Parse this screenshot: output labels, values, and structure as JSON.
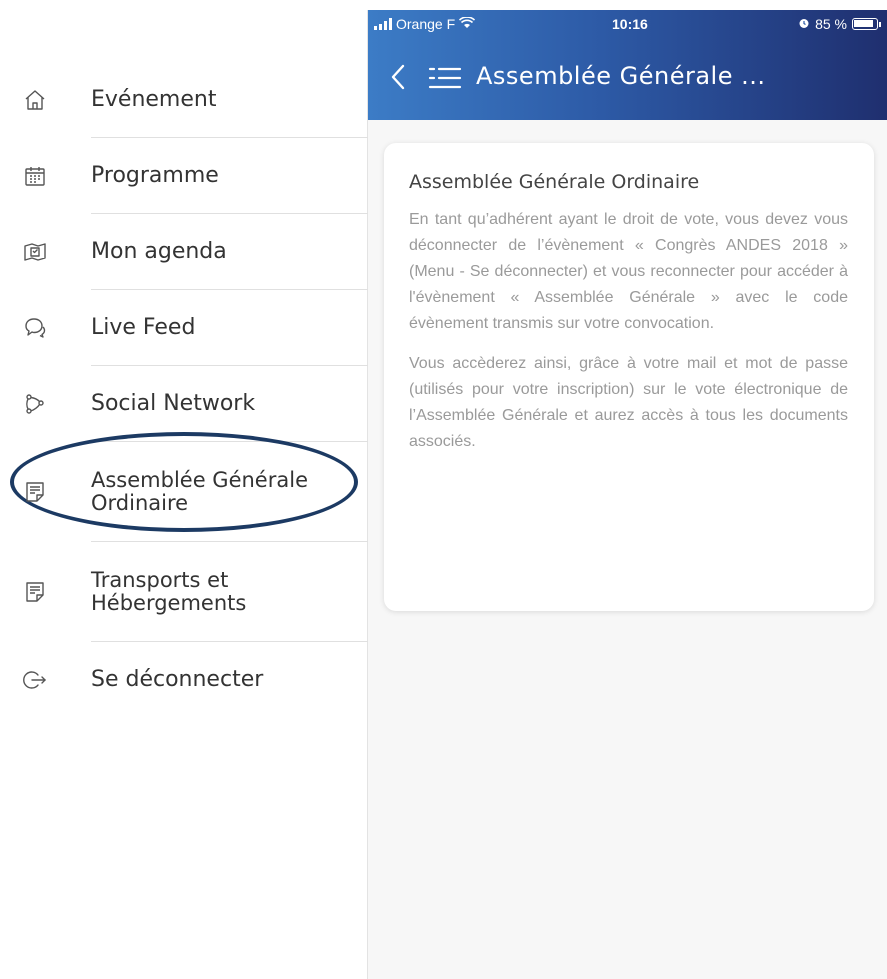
{
  "status_bar": {
    "carrier": "Orange F",
    "time": "10:16",
    "battery": "85 %"
  },
  "navbar": {
    "title": "Assemblée Générale ..."
  },
  "sidebar": {
    "items": [
      {
        "label": "Evénement",
        "icon": "home-icon"
      },
      {
        "label": "Programme",
        "icon": "calendar-icon"
      },
      {
        "label": "Mon agenda",
        "icon": "agenda-icon"
      },
      {
        "label": "Live Feed",
        "icon": "chat-bubbles-icon"
      },
      {
        "label": "Social Network",
        "icon": "network-icon"
      },
      {
        "label": "Assemblée Générale Ordinaire",
        "icon": "document-icon"
      },
      {
        "label": "Transports et Hébergements",
        "icon": "document-icon"
      },
      {
        "label": "Se déconnecter",
        "icon": "logout-icon"
      }
    ]
  },
  "card": {
    "title": "Assemblée Générale Ordinaire",
    "paragraphs": [
      "En tant qu’adhérent ayant le droit de vote, vous devez vous déconnecter de l’évènement « Congrès ANDES 2018 » (Menu - Se déconnecter) et vous reconnecter pour accéder à l'évènement « Assemblée Générale » avec le code évènement transmis sur votre convocation.",
      "Vous accèderez ainsi, grâce à votre mail et mot de passe (utilisés pour votre inscription) sur le vote électronique de l’Assemblée Générale et aurez accès à tous les documents associés."
    ]
  },
  "colors": {
    "header_gradient_start": "#3c7cc6",
    "header_gradient_end": "#1f2f6f",
    "highlight_oval": "#1c3a63",
    "body_text": "#9a9a9a"
  }
}
